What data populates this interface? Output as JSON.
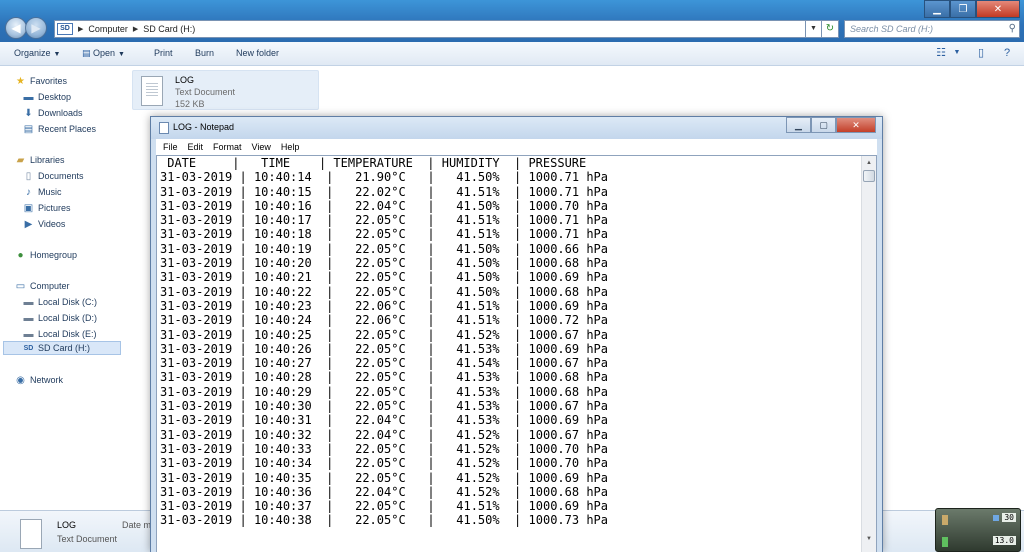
{
  "explorer": {
    "breadcrumb": [
      "Computer",
      "SD Card (H:)"
    ],
    "drive_icon_text": "SD",
    "search_placeholder": "Search SD Card (H:)",
    "toolbar": {
      "organize": "Organize",
      "open": "Open",
      "print": "Print",
      "burn": "Burn",
      "new_folder": "New folder"
    },
    "nav": {
      "favorites": "Favorites",
      "desktop": "Desktop",
      "downloads": "Downloads",
      "recent_places": "Recent Places",
      "libraries": "Libraries",
      "documents": "Documents",
      "music": "Music",
      "pictures": "Pictures",
      "videos": "Videos",
      "homegroup": "Homegroup",
      "computer": "Computer",
      "local_c": "Local Disk (C:)",
      "local_d": "Local Disk (D:)",
      "local_e": "Local Disk (E:)",
      "sd_card": "SD Card (H:)",
      "network": "Network"
    },
    "file": {
      "name": "LOG",
      "type": "Text Document",
      "size": "152 KB"
    },
    "details": {
      "name": "LOG",
      "type": "Text Document",
      "date_label": "Date m"
    },
    "gadget": {
      "top_value": "30",
      "bottom_value": "13.0"
    }
  },
  "notepad": {
    "title": "LOG - Notepad",
    "menu": [
      "File",
      "Edit",
      "Format",
      "View",
      "Help"
    ],
    "header": " DATE     |   TIME    | TEMPERATURE  | HUMIDITY  | PRESSURE",
    "log_rows": [
      {
        "date": "31-03-2019",
        "time": "10:40:14",
        "temperature": "21.90°C",
        "humidity": "41.50%",
        "pressure": "1000.71 hPa"
      },
      {
        "date": "31-03-2019",
        "time": "10:40:15",
        "temperature": "22.02°C",
        "humidity": "41.51%",
        "pressure": "1000.71 hPa"
      },
      {
        "date": "31-03-2019",
        "time": "10:40:16",
        "temperature": "22.04°C",
        "humidity": "41.50%",
        "pressure": "1000.70 hPa"
      },
      {
        "date": "31-03-2019",
        "time": "10:40:17",
        "temperature": "22.05°C",
        "humidity": "41.51%",
        "pressure": "1000.71 hPa"
      },
      {
        "date": "31-03-2019",
        "time": "10:40:18",
        "temperature": "22.05°C",
        "humidity": "41.51%",
        "pressure": "1000.71 hPa"
      },
      {
        "date": "31-03-2019",
        "time": "10:40:19",
        "temperature": "22.05°C",
        "humidity": "41.50%",
        "pressure": "1000.66 hPa"
      },
      {
        "date": "31-03-2019",
        "time": "10:40:20",
        "temperature": "22.05°C",
        "humidity": "41.50%",
        "pressure": "1000.68 hPa"
      },
      {
        "date": "31-03-2019",
        "time": "10:40:21",
        "temperature": "22.05°C",
        "humidity": "41.50%",
        "pressure": "1000.69 hPa"
      },
      {
        "date": "31-03-2019",
        "time": "10:40:22",
        "temperature": "22.05°C",
        "humidity": "41.50%",
        "pressure": "1000.68 hPa"
      },
      {
        "date": "31-03-2019",
        "time": "10:40:23",
        "temperature": "22.06°C",
        "humidity": "41.51%",
        "pressure": "1000.69 hPa"
      },
      {
        "date": "31-03-2019",
        "time": "10:40:24",
        "temperature": "22.06°C",
        "humidity": "41.51%",
        "pressure": "1000.72 hPa"
      },
      {
        "date": "31-03-2019",
        "time": "10:40:25",
        "temperature": "22.05°C",
        "humidity": "41.52%",
        "pressure": "1000.67 hPa"
      },
      {
        "date": "31-03-2019",
        "time": "10:40:26",
        "temperature": "22.05°C",
        "humidity": "41.53%",
        "pressure": "1000.69 hPa"
      },
      {
        "date": "31-03-2019",
        "time": "10:40:27",
        "temperature": "22.05°C",
        "humidity": "41.54%",
        "pressure": "1000.67 hPa"
      },
      {
        "date": "31-03-2019",
        "time": "10:40:28",
        "temperature": "22.05°C",
        "humidity": "41.53%",
        "pressure": "1000.68 hPa"
      },
      {
        "date": "31-03-2019",
        "time": "10:40:29",
        "temperature": "22.05°C",
        "humidity": "41.53%",
        "pressure": "1000.68 hPa"
      },
      {
        "date": "31-03-2019",
        "time": "10:40:30",
        "temperature": "22.05°C",
        "humidity": "41.53%",
        "pressure": "1000.67 hPa"
      },
      {
        "date": "31-03-2019",
        "time": "10:40:31",
        "temperature": "22.04°C",
        "humidity": "41.53%",
        "pressure": "1000.69 hPa"
      },
      {
        "date": "31-03-2019",
        "time": "10:40:32",
        "temperature": "22.04°C",
        "humidity": "41.52%",
        "pressure": "1000.67 hPa"
      },
      {
        "date": "31-03-2019",
        "time": "10:40:33",
        "temperature": "22.05°C",
        "humidity": "41.52%",
        "pressure": "1000.70 hPa"
      },
      {
        "date": "31-03-2019",
        "time": "10:40:34",
        "temperature": "22.05°C",
        "humidity": "41.52%",
        "pressure": "1000.70 hPa"
      },
      {
        "date": "31-03-2019",
        "time": "10:40:35",
        "temperature": "22.05°C",
        "humidity": "41.52%",
        "pressure": "1000.69 hPa"
      },
      {
        "date": "31-03-2019",
        "time": "10:40:36",
        "temperature": "22.04°C",
        "humidity": "41.52%",
        "pressure": "1000.68 hPa"
      },
      {
        "date": "31-03-2019",
        "time": "10:40:37",
        "temperature": "22.05°C",
        "humidity": "41.51%",
        "pressure": "1000.69 hPa"
      },
      {
        "date": "31-03-2019",
        "time": "10:40:38",
        "temperature": "22.05°C",
        "humidity": "41.50%",
        "pressure": "1000.73 hPa"
      }
    ]
  },
  "icons": {
    "back": "back-arrow-icon",
    "forward": "forward-arrow-icon",
    "refresh": "refresh-icon",
    "search": "search-icon",
    "favorites": "star-icon",
    "folder": "folder-icon",
    "drive": "drive-icon",
    "network": "network-icon",
    "document": "text-document-icon"
  },
  "colors": {
    "titlebar": "#2d72b8",
    "selection": "#d9e7f8",
    "close_button": "#c23a24"
  }
}
